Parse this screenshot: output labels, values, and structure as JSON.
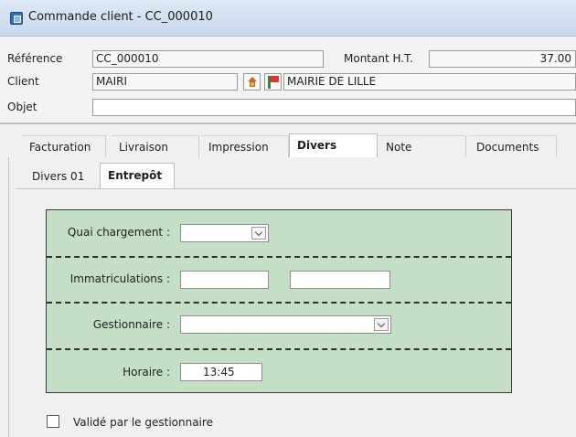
{
  "window": {
    "title": "Commande client - CC_000010"
  },
  "header": {
    "reference_label": "Référence",
    "reference_value": "CC_000010",
    "montant_label": "Montant H.T.",
    "montant_value": "37.00",
    "client_label": "Client",
    "client_code": "MAIRI",
    "client_name": "MAIRIE DE LILLE",
    "objet_label": "Objet",
    "objet_value": ""
  },
  "tabs": [
    "Facturation",
    "Livraison",
    "Impression",
    "Divers",
    "Note",
    "Documents"
  ],
  "active_tab": "Divers",
  "subtabs": [
    "Divers 01",
    "Entrepôt"
  ],
  "active_subtab": "Entrepôt",
  "warehouse": {
    "quai_label": "Quai chargement :",
    "quai_value": "",
    "immat_label": "Immatriculations :",
    "immat_value_1": "",
    "immat_value_2": "",
    "gestionnaire_label": "Gestionnaire :",
    "gestionnaire_value": "",
    "horaire_label": "Horaire :",
    "horaire_value": "13:45",
    "valide_label": "Validé par le gestionnaire",
    "valide_checked": false
  },
  "icons": {
    "app": "document-icon",
    "home": "house-icon",
    "status": "flag-icon"
  },
  "colors": {
    "warehouse_bg": "#c5dfc6",
    "titlebar": "#d3e1f1"
  }
}
